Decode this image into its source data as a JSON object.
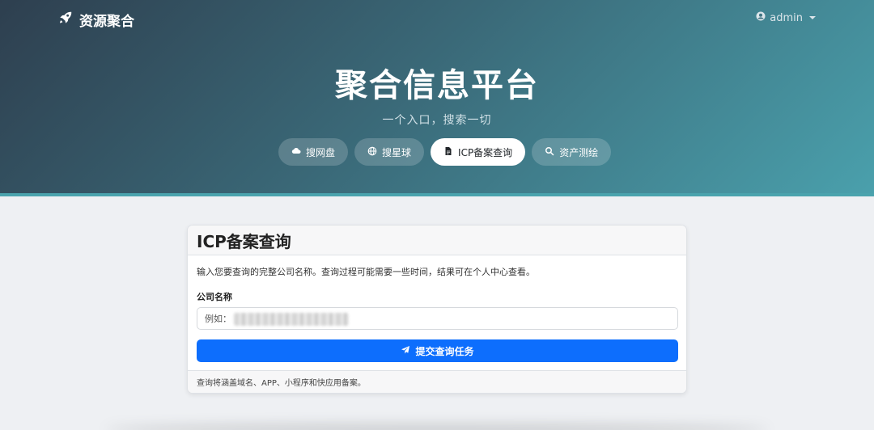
{
  "navbar": {
    "brand_icon": "rocket-icon",
    "brand": "资源聚合",
    "user_icon": "user-circle-icon",
    "user": "admin"
  },
  "hero": {
    "title": "聚合信息平台",
    "subtitle": "一个入口，搜索一切"
  },
  "tabs": [
    {
      "label": "搜网盘",
      "icon": "cloud-icon",
      "active": false
    },
    {
      "label": "搜星球",
      "icon": "globe-icon",
      "active": false
    },
    {
      "label": "ICP备案查询",
      "icon": "file-icon",
      "active": true
    },
    {
      "label": "资产测绘",
      "icon": "search-icon",
      "active": false
    }
  ],
  "card": {
    "title": "ICP备案查询",
    "description": "输入您要查询的完整公司名称。查询过程可能需要一些时间，结果可在个人中心查看。",
    "field_label": "公司名称",
    "input_placeholder": "例如：",
    "submit_icon": "paper-plane-icon",
    "submit_label": "提交查询任务",
    "footer": "查询将涵盖域名、APP、小程序和快应用备案。"
  },
  "colors": {
    "primary": "#0d6efd",
    "hero_start": "#2e3f4f",
    "hero_end": "#4aa0ac"
  }
}
